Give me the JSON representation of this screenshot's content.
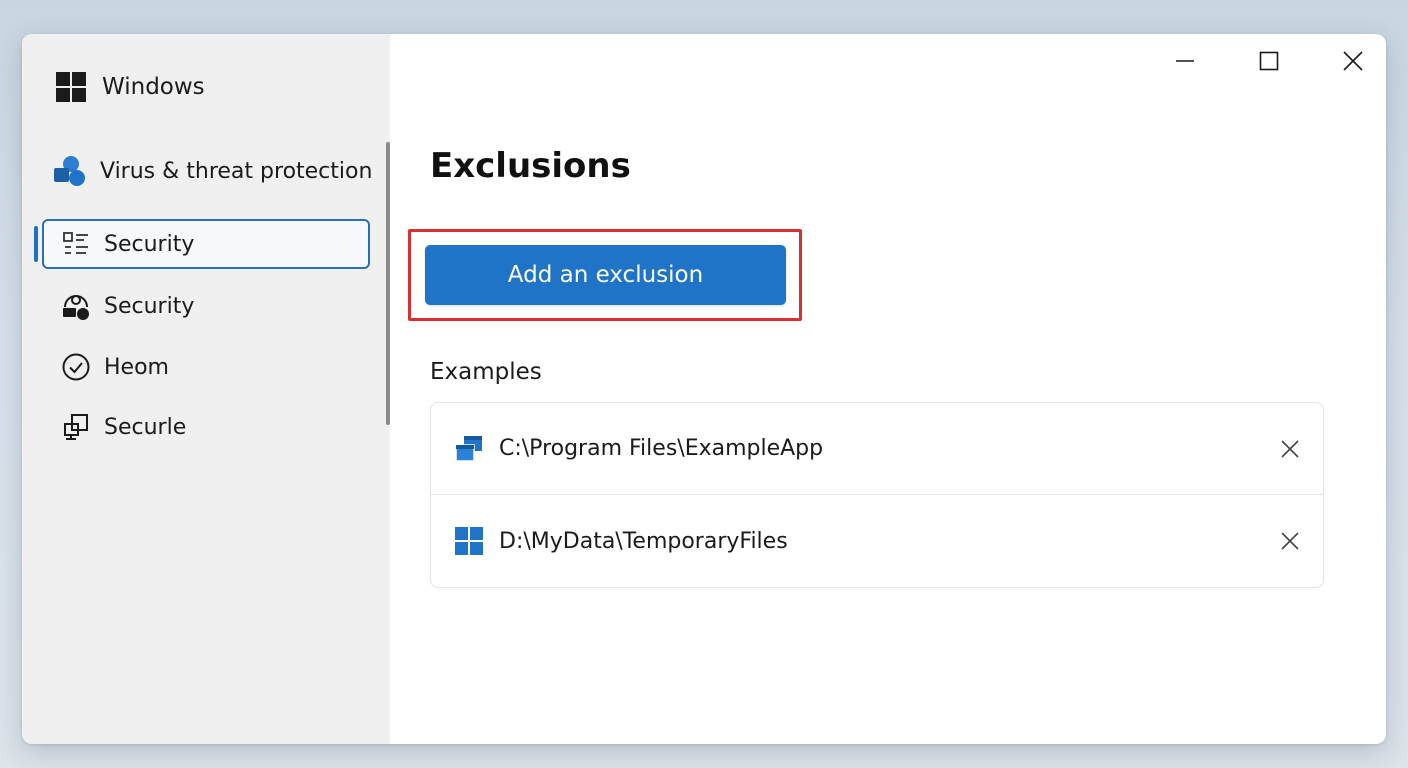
{
  "sidebar": {
    "brand_title": "Windows",
    "items": [
      {
        "label": "Virus & threat protection",
        "icon": "shapes-icon"
      },
      {
        "label": "Security",
        "icon": "list-icon",
        "selected": true
      },
      {
        "label": "Security",
        "icon": "people-lock-icon"
      },
      {
        "label": "Heom",
        "icon": "check-circle-icon"
      },
      {
        "label": "Securle",
        "icon": "device-icon"
      }
    ]
  },
  "main": {
    "title": "Exclusions",
    "add_button_label": "Add an exclusion",
    "examples_label": "Examples",
    "exclusions": [
      {
        "path": "C:\\Program Files\\ExampleApp",
        "icon": "app-windows-icon"
      },
      {
        "path": "D:\\MyData\\TemporaryFiles",
        "icon": "windows-logo-icon"
      }
    ]
  },
  "colors": {
    "accent": "#1f74c8",
    "highlight": "#d9302f",
    "sidebar_bg": "#f0f0f0"
  }
}
